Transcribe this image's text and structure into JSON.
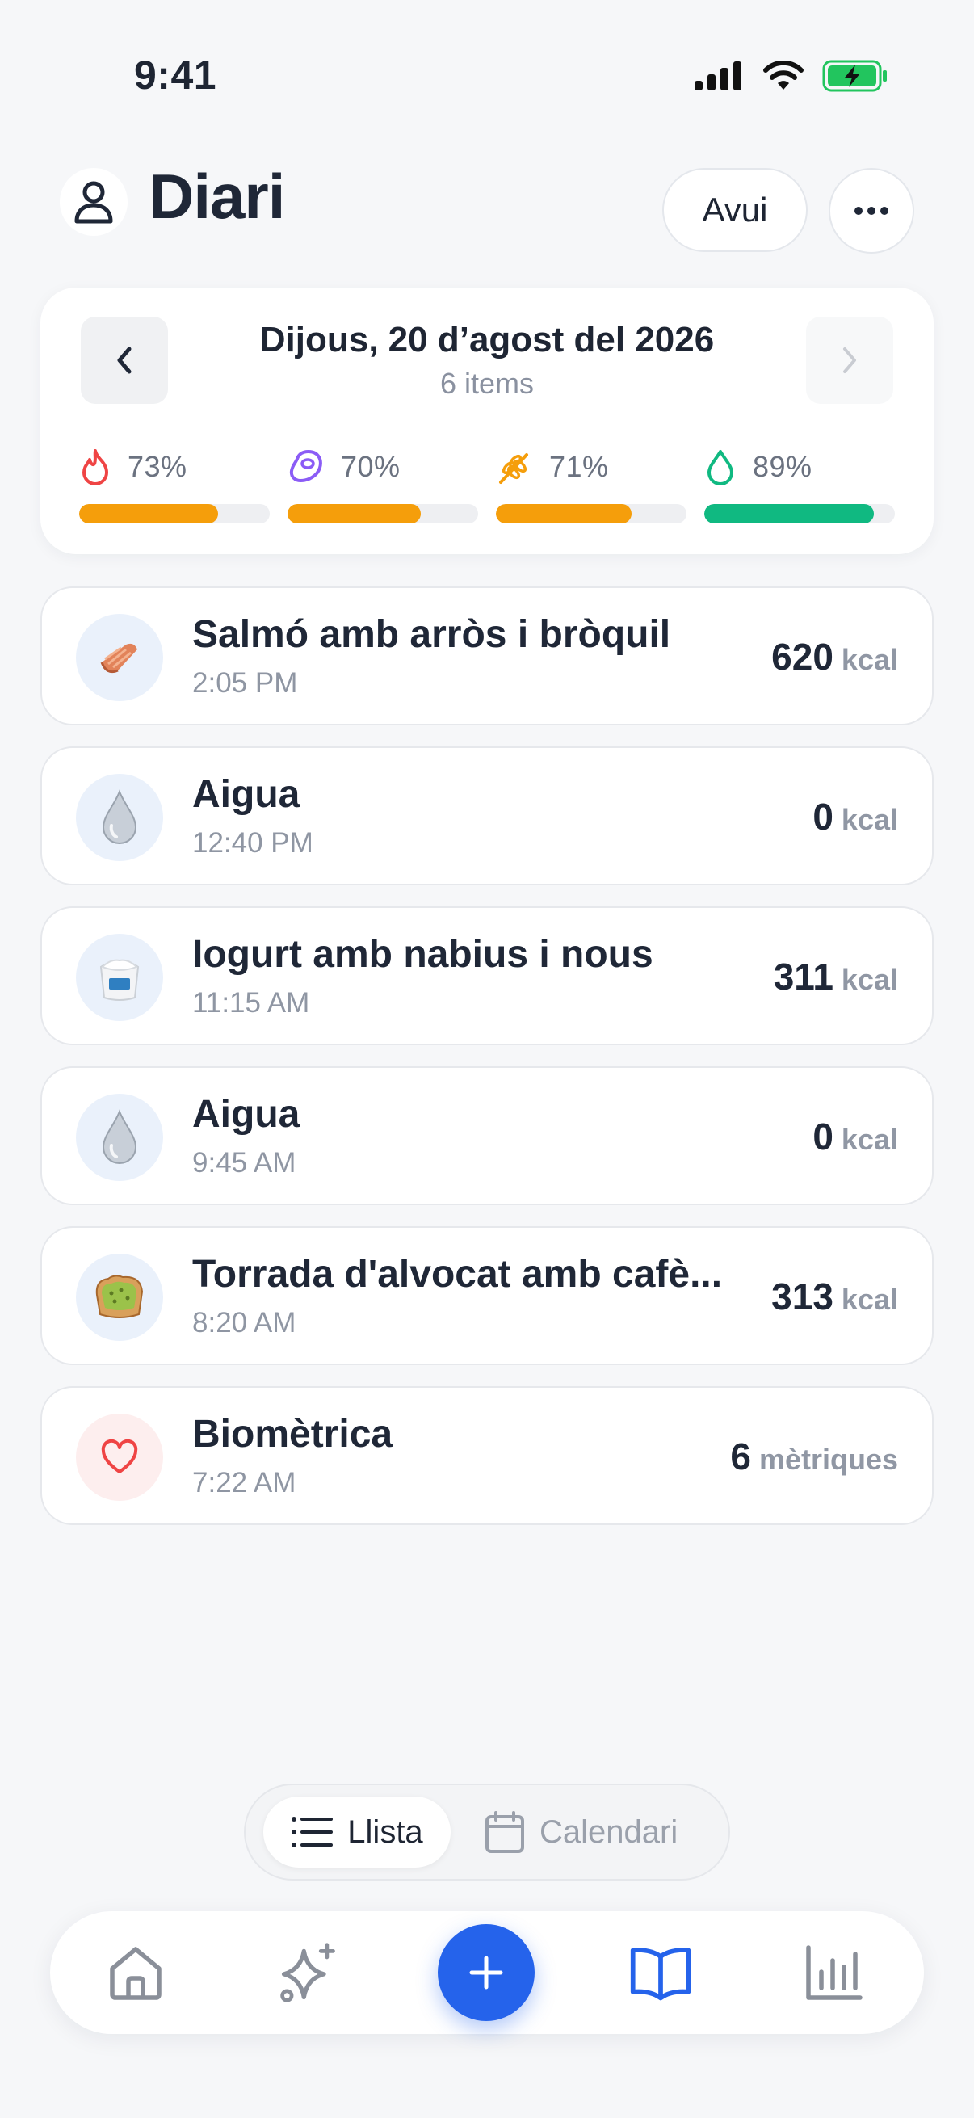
{
  "status_bar": {
    "time": "9:41"
  },
  "header": {
    "title": "Diari",
    "today_label": "Avui"
  },
  "day_summary": {
    "date": "Dijous, 20 d’agost del 2026",
    "items_count": "6 items",
    "macros": [
      {
        "name": "flame-icon",
        "percent_label": "73%",
        "value": 0.73,
        "color": "#f59e0b",
        "icon_color": "#ef4444"
      },
      {
        "name": "meat-icon",
        "percent_label": "70%",
        "value": 0.7,
        "color": "#f59e0b",
        "icon_color": "#8b5cf6"
      },
      {
        "name": "wheat-icon",
        "percent_label": "71%",
        "value": 0.71,
        "color": "#f59e0b",
        "icon_color": "#f59e0b"
      },
      {
        "name": "drop-icon",
        "percent_label": "89%",
        "value": 0.89,
        "color": "#10b981",
        "icon_color": "#10b981"
      }
    ]
  },
  "entries": [
    {
      "name": "Salmó amb arròs i bròquil",
      "time": "2:05 PM",
      "value": "620",
      "unit": "kcal",
      "icon": "salmon-icon"
    },
    {
      "name": "Aigua",
      "time": "12:40 PM",
      "value": "0",
      "unit": "kcal",
      "icon": "water-drop-icon"
    },
    {
      "name": "Iogurt amb nabius i nous",
      "time": "11:15 AM",
      "value": "311",
      "unit": "kcal",
      "icon": "yogurt-icon"
    },
    {
      "name": "Aigua",
      "time": "9:45 AM",
      "value": "0",
      "unit": "kcal",
      "icon": "water-drop-icon"
    },
    {
      "name": "Torrada d'alvocat amb cafè...",
      "time": "8:20 AM",
      "value": "313",
      "unit": "kcal",
      "icon": "avocado-toast-icon"
    },
    {
      "name": "Biomètrica",
      "time": "7:22 AM",
      "value": "6",
      "unit": "mètriques",
      "icon": "heart-icon"
    }
  ],
  "view_toggle": {
    "list_label": "Llista",
    "calendar_label": "Calendari",
    "selected": "Llista"
  },
  "tab_bar": {
    "tabs": [
      "home-icon",
      "sparkles-icon",
      "add-icon",
      "journal-book-icon",
      "stats-chart-icon"
    ],
    "active": "journal-book-icon",
    "accent": "#2563eb"
  }
}
